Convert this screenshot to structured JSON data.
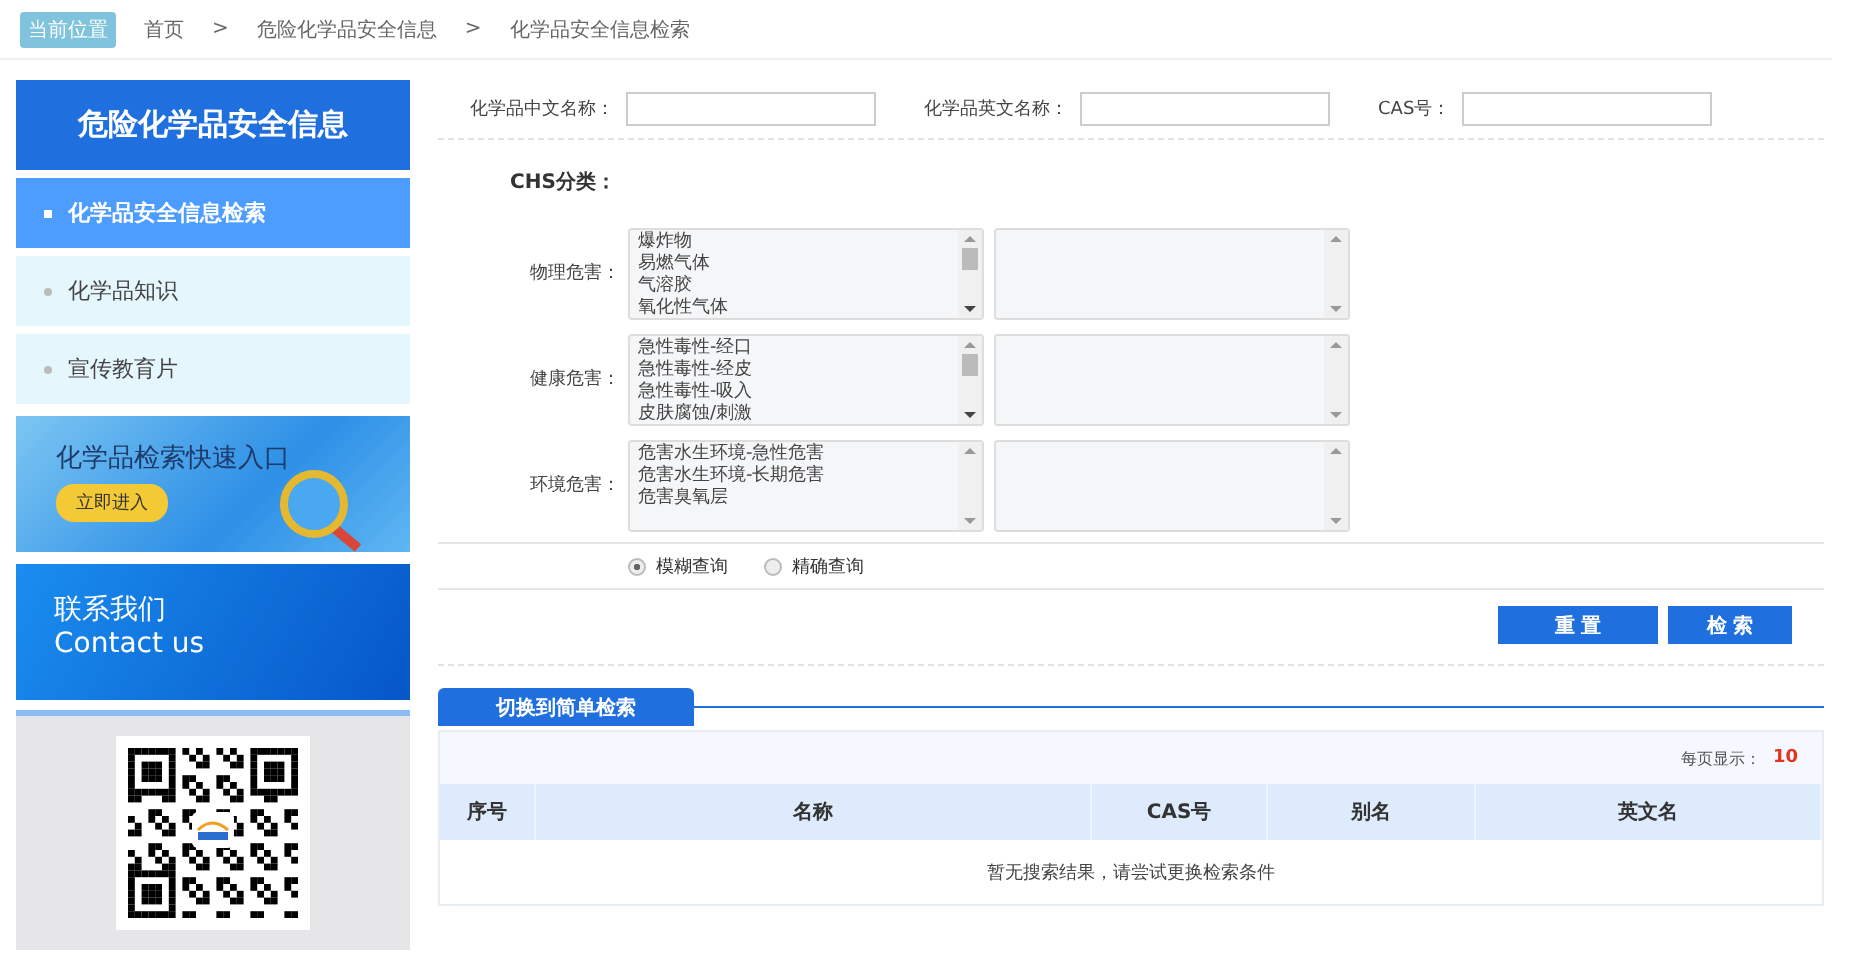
{
  "breadcrumb": {
    "badge": "当前位置",
    "items": [
      "首页",
      "危险化学品安全信息",
      "化学品安全信息检索"
    ],
    "separator": ">"
  },
  "sidebar": {
    "title": "危险化学品安全信息",
    "items": [
      {
        "label": "化学品安全信息检索",
        "selected": true
      },
      {
        "label": "化学品知识",
        "selected": false
      },
      {
        "label": "宣传教育片",
        "selected": false
      }
    ],
    "quick_banner": {
      "title": "化学品检索快速入口",
      "button": "立即进入"
    },
    "contact_banner": {
      "title": "联系我们",
      "subtitle": "Contact us"
    }
  },
  "search_form": {
    "fields": [
      {
        "label": "化学品中文名称："
      },
      {
        "label": "化学品英文名称："
      },
      {
        "label": "CAS号："
      }
    ],
    "ghs_label": "CHS分类：",
    "hazard_groups": [
      {
        "label": "物理危害：",
        "options": [
          "爆炸物",
          "易燃气体",
          "气溶胶",
          "氧化性气体"
        ]
      },
      {
        "label": "健康危害：",
        "options": [
          "急性毒性-经口",
          "急性毒性-经皮",
          "急性毒性-吸入",
          "皮肤腐蚀/刺激"
        ]
      },
      {
        "label": "环境危害：",
        "options": [
          "危害水生环境-急性危害",
          "危害水生环境-长期危害",
          "危害臭氧层"
        ]
      }
    ],
    "match_modes": [
      {
        "label": "模糊查询",
        "selected": true
      },
      {
        "label": "精确查询",
        "selected": false
      }
    ],
    "buttons": [
      "重 置",
      "检 索"
    ]
  },
  "results": {
    "switch_tab": "切换到简单检索",
    "page_size_label": "每页显示：",
    "page_size": "10",
    "columns": [
      "序号",
      "名称",
      "CAS号",
      "别名",
      "英文名"
    ],
    "empty_message": "暂无搜索结果，请尝试更换检索条件"
  }
}
